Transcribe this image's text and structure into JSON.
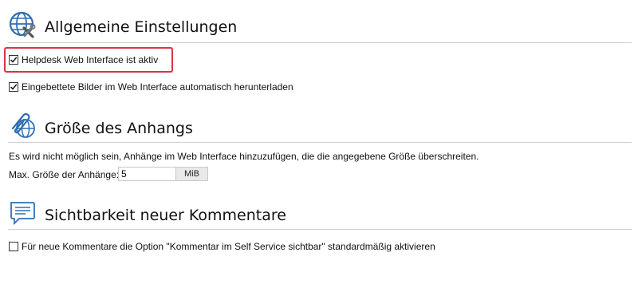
{
  "general": {
    "title": "Allgemeine Einstellungen",
    "icon": "globe-tools-icon",
    "options": [
      {
        "label": "Helpdesk Web Interface ist aktiv",
        "checked": true
      },
      {
        "label": "Eingebettete Bilder im Web Interface automatisch herunterladen",
        "checked": true
      }
    ]
  },
  "attachments": {
    "title": "Größe des Anhangs",
    "icon": "paperclip-globe-icon",
    "description": "Es wird nicht möglich sein, Anhänge im Web Interface hinzuzufügen, die die angegebene Größe überschreiten.",
    "max_size_label": "Max. Größe der Anhänge:",
    "max_size_value": "5",
    "unit": "MiB"
  },
  "comments": {
    "title": "Sichtbarkeit neuer Kommentare",
    "icon": "speech-bubble-icon",
    "option": {
      "label": "Für neue Kommentare die Option \"Kommentar im Self Service sichtbar\" standardmäßig aktivieren",
      "checked": false
    }
  },
  "colors": {
    "icon_blue": "#2f6fb5",
    "highlight_red": "#d9363e"
  }
}
